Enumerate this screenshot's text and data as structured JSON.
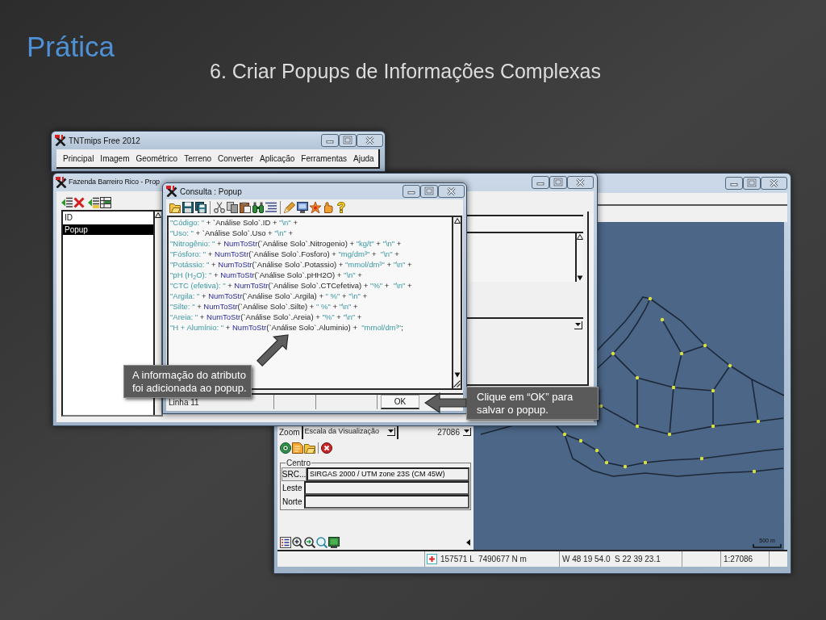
{
  "slide": {
    "title": "Prática",
    "subtitle": "6. Criar Popups de Informações Complexas"
  },
  "main_window": {
    "title": "TNTmips Free 2012",
    "menu": [
      "Principal",
      "Imagem",
      "Geométrico",
      "Terreno",
      "Converter",
      "Aplicação",
      "Ferramentas",
      "Ajuda"
    ]
  },
  "table_window": {
    "title": "Fazenda Barreiro Rico - Prop",
    "fields": [
      {
        "label": "ID",
        "selected": false
      },
      {
        "label": "Popup",
        "selected": true
      }
    ]
  },
  "query_window": {
    "title": "Consulta : Popup",
    "code_lines": [
      {
        "tokens": [
          {
            "kind": "string",
            "text": "\"Código: \""
          },
          {
            "kind": "plain",
            "text": " + `Análise Solo`.ID + "
          },
          {
            "kind": "string",
            "text": "\"\\n\""
          },
          {
            "kind": "plain",
            "text": " +"
          }
        ]
      },
      {
        "tokens": [
          {
            "kind": "string",
            "text": "\"Uso: \""
          },
          {
            "kind": "plain",
            "text": " + `Análise Solo`.Uso + "
          },
          {
            "kind": "string",
            "text": "\"\\n\""
          },
          {
            "kind": "plain",
            "text": " +"
          }
        ]
      },
      {
        "tokens": [
          {
            "kind": "string",
            "text": "\"Nitrogênio: \""
          },
          {
            "kind": "plain",
            "text": " + "
          },
          {
            "kind": "function",
            "text": "NumToStr"
          },
          {
            "kind": "plain",
            "text": "(`Análise Solo`.Nitrogenio) + "
          },
          {
            "kind": "string",
            "text": "\"kg/t\""
          },
          {
            "kind": "plain",
            "text": " + "
          },
          {
            "kind": "string",
            "text": "\"\\n\""
          },
          {
            "kind": "plain",
            "text": " +"
          }
        ]
      },
      {
        "tokens": [
          {
            "kind": "string",
            "text": "\"Fósforo: \""
          },
          {
            "kind": "plain",
            "text": " + "
          },
          {
            "kind": "function",
            "text": "NumToStr"
          },
          {
            "kind": "plain",
            "text": "(`Análise Solo`.Fosforo) + "
          },
          {
            "kind": "string",
            "text": "\"mg/dm³\""
          },
          {
            "kind": "plain",
            "text": " +  "
          },
          {
            "kind": "string",
            "text": "\"\\n\""
          },
          {
            "kind": "plain",
            "text": " +"
          }
        ]
      },
      {
        "tokens": [
          {
            "kind": "string",
            "text": "\"Potássio: \""
          },
          {
            "kind": "plain",
            "text": " + "
          },
          {
            "kind": "function",
            "text": "NumToStr"
          },
          {
            "kind": "plain",
            "text": "(`Análise Solo`.Potassio) + "
          },
          {
            "kind": "string",
            "text": "\"mmol/dm³\""
          },
          {
            "kind": "plain",
            "text": " + "
          },
          {
            "kind": "string",
            "text": "\"\\n\""
          },
          {
            "kind": "plain",
            "text": " +"
          }
        ]
      },
      {
        "tokens": [
          {
            "kind": "string",
            "text": "\"pH (H$_{2}$O): \""
          },
          {
            "kind": "plain",
            "text": " + "
          },
          {
            "kind": "function",
            "text": "NumToStr"
          },
          {
            "kind": "plain",
            "text": "(`Análise Solo`.pHH2O) + "
          },
          {
            "kind": "string",
            "text": "\"\\n\""
          },
          {
            "kind": "plain",
            "text": " +"
          }
        ]
      },
      {
        "tokens": [
          {
            "kind": "string",
            "text": "\"CTC (efetiva): \""
          },
          {
            "kind": "plain",
            "text": " + "
          },
          {
            "kind": "function",
            "text": "NumToStr"
          },
          {
            "kind": "plain",
            "text": "(`Análise Solo`.CTCefetiva) + "
          },
          {
            "kind": "string",
            "text": "\"%\""
          },
          {
            "kind": "plain",
            "text": " +  "
          },
          {
            "kind": "string",
            "text": "\"\\n\""
          },
          {
            "kind": "plain",
            "text": " +"
          }
        ]
      },
      {
        "tokens": [
          {
            "kind": "string",
            "text": "\"Argila: \""
          },
          {
            "kind": "plain",
            "text": " + "
          },
          {
            "kind": "function",
            "text": "NumToStr"
          },
          {
            "kind": "plain",
            "text": "(`Análise Solo`.Argila) + "
          },
          {
            "kind": "string",
            "text": "\" %\""
          },
          {
            "kind": "plain",
            "text": " + "
          },
          {
            "kind": "string",
            "text": "\"\\n\""
          },
          {
            "kind": "plain",
            "text": " +"
          }
        ]
      },
      {
        "tokens": [
          {
            "kind": "string",
            "text": "\"Silte: \""
          },
          {
            "kind": "plain",
            "text": " + "
          },
          {
            "kind": "function",
            "text": "NumToStr"
          },
          {
            "kind": "plain",
            "text": "(`Análise Solo`.Silte) + "
          },
          {
            "kind": "string",
            "text": "\" %\""
          },
          {
            "kind": "plain",
            "text": " + "
          },
          {
            "kind": "string",
            "text": "\"\\n\""
          },
          {
            "kind": "plain",
            "text": " +"
          }
        ]
      },
      {
        "tokens": [
          {
            "kind": "string",
            "text": "\"Areia: \""
          },
          {
            "kind": "plain",
            "text": " + "
          },
          {
            "kind": "function",
            "text": "NumToStr"
          },
          {
            "kind": "plain",
            "text": "(`Análise Solo`.Areia) + "
          },
          {
            "kind": "string",
            "text": "\"%\""
          },
          {
            "kind": "plain",
            "text": " + "
          },
          {
            "kind": "string",
            "text": "\"\\n\""
          },
          {
            "kind": "plain",
            "text": " +"
          }
        ]
      },
      {
        "tokens": [
          {
            "kind": "string",
            "text": "\"H + Alumínio: \""
          },
          {
            "kind": "plain",
            "text": " + "
          },
          {
            "kind": "function",
            "text": "NumToStr"
          },
          {
            "kind": "plain",
            "text": "(`Análise Solo`.Aluminio) +  "
          },
          {
            "kind": "string",
            "text": "\"mmol/dm³\""
          },
          {
            "kind": "plain",
            "text": ";"
          }
        ]
      }
    ],
    "status": "Linha 11",
    "ok_button": "OK"
  },
  "view_window": {
    "zoom_label": "Zoom",
    "zoom_mode": "Escala da Visualização",
    "zoom_scale": "27086",
    "center_group": "Centro",
    "crs_button": "SRC...",
    "crs_value": "SIRGAS 2000 / UTM zone 23S (CM 45W)",
    "east_label": "Leste",
    "north_label": "Norte",
    "scale_bar_label": "500 m",
    "status_bar": {
      "projected": "157571 L  7490677 N m",
      "geographic": "W 48 19 54.0  S 22 39 23.1",
      "scale": "1:27086"
    }
  },
  "callouts": [
    {
      "text": "A informação do atributo foi adicionada ao popup."
    },
    {
      "text": "Clique em “OK” para salvar o popup."
    }
  ]
}
